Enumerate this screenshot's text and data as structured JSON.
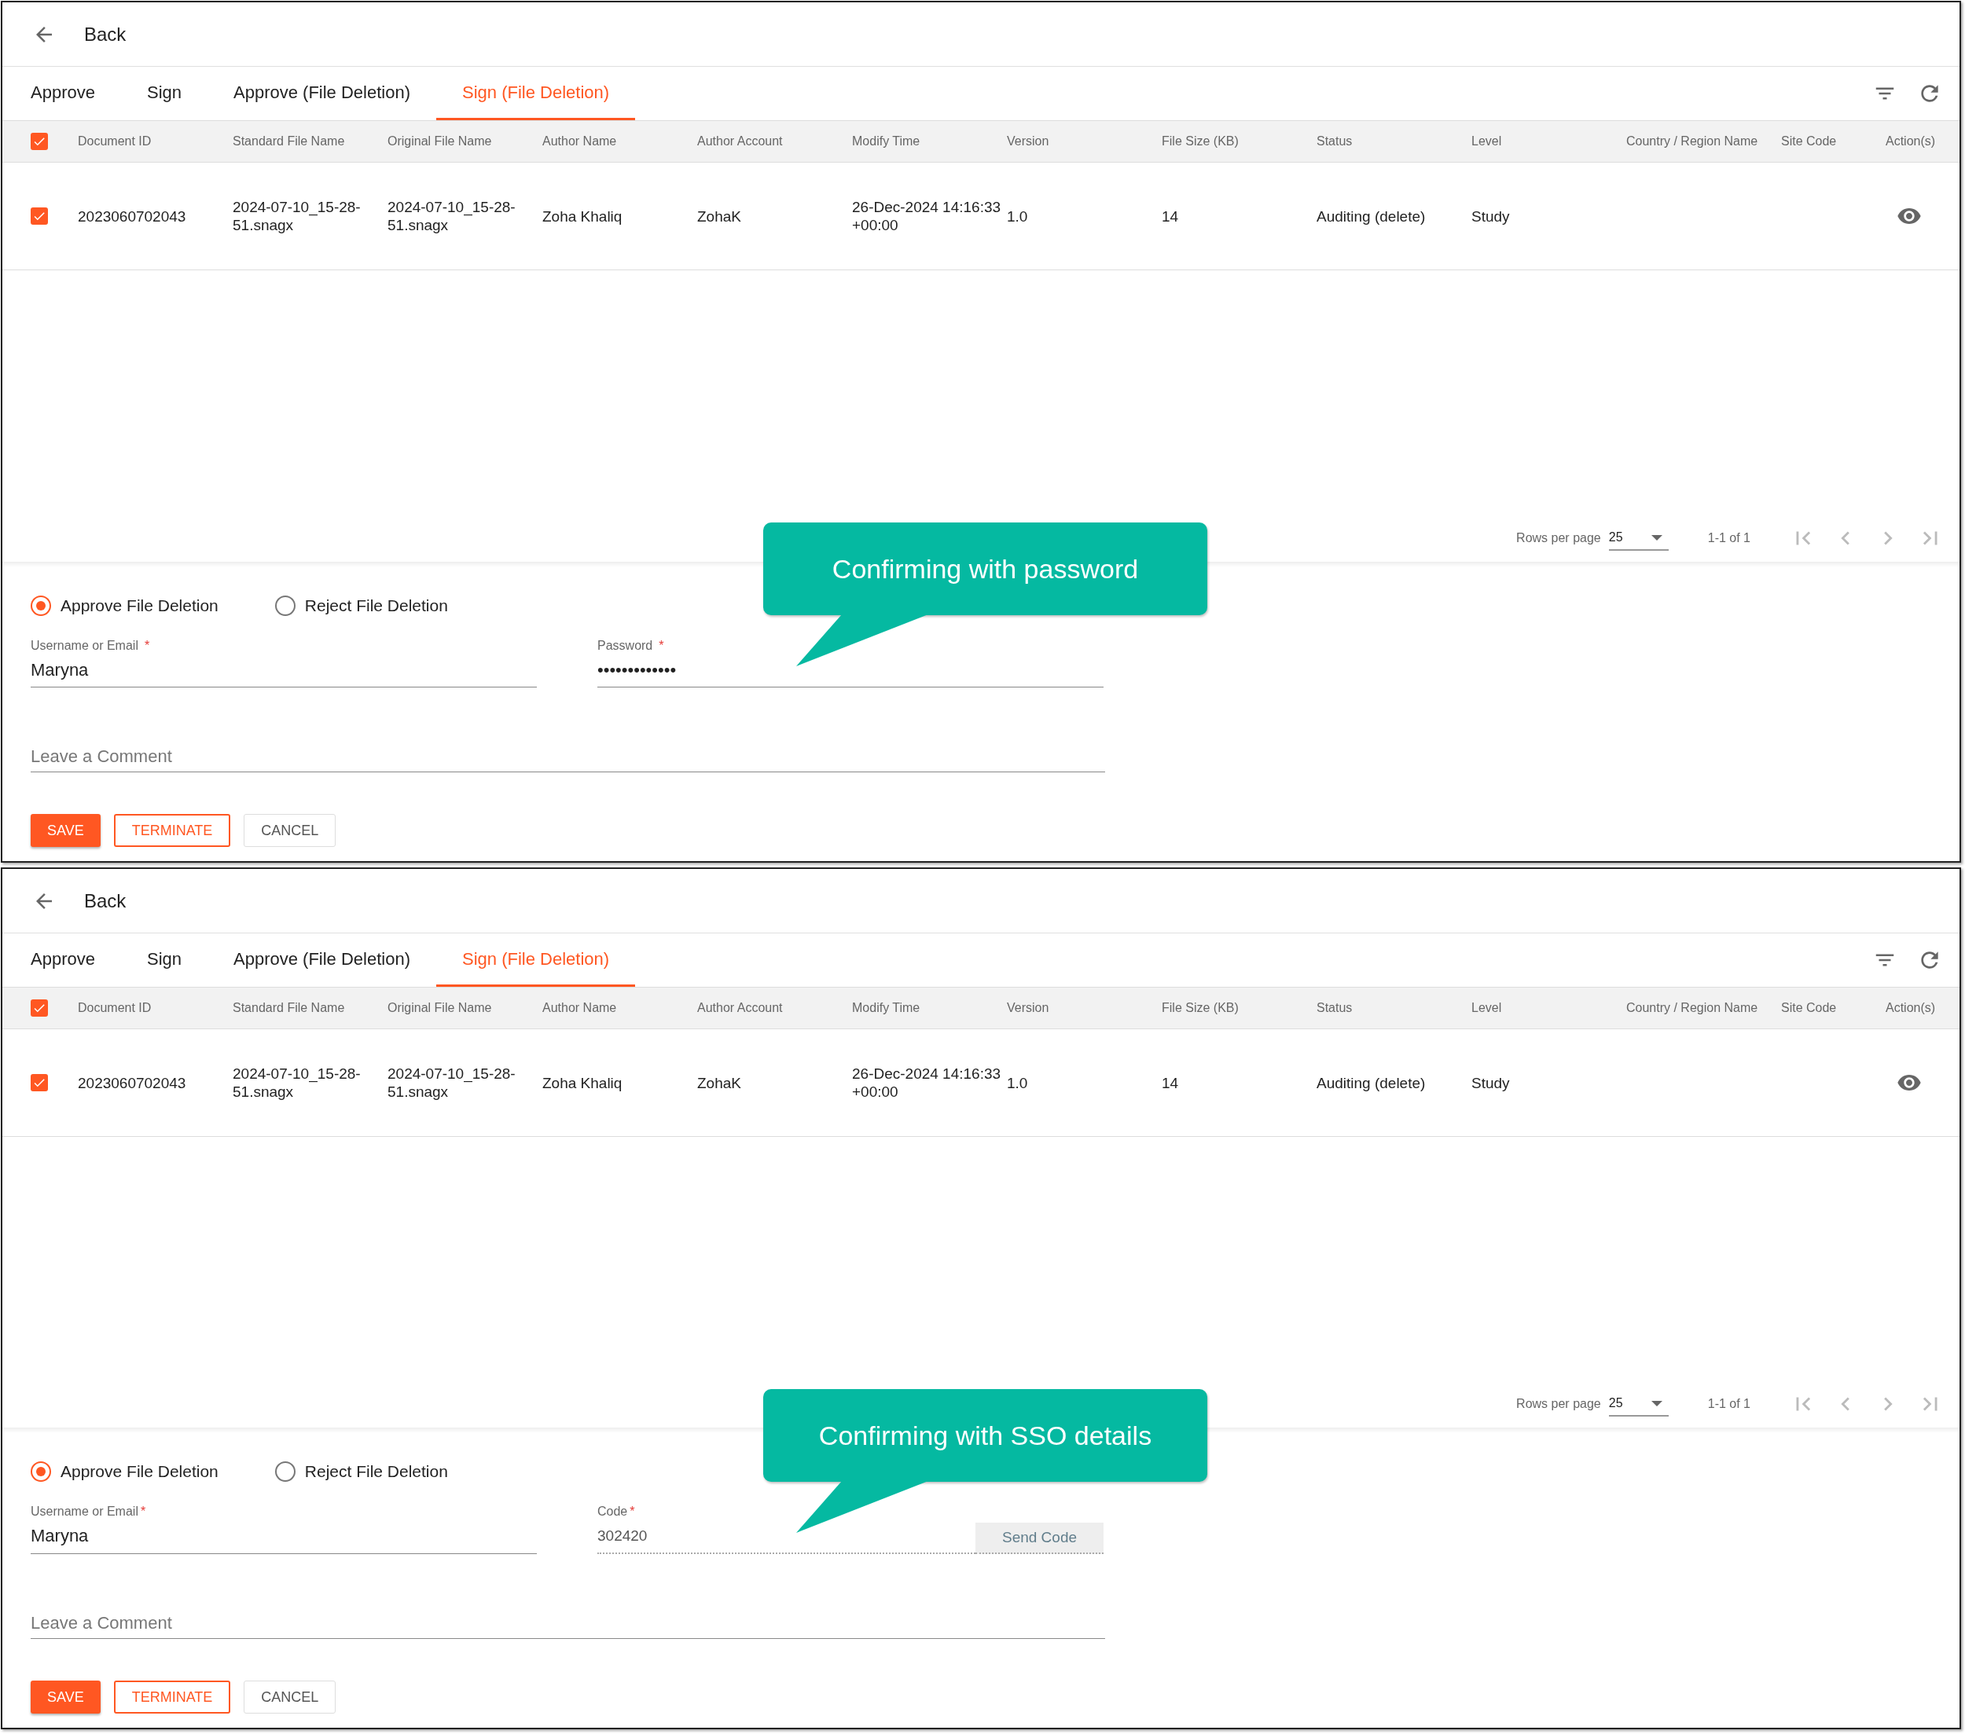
{
  "panels": [
    {
      "back": "Back",
      "tabs": [
        {
          "label": "Approve",
          "selected": false
        },
        {
          "label": "Sign",
          "selected": false
        },
        {
          "label": "Approve (File Deletion)",
          "selected": false
        },
        {
          "label": "Sign (File Deletion)",
          "selected": true
        }
      ],
      "header_checked": true,
      "columns": [
        "Document ID",
        "Standard File Name",
        "Original File Name",
        "Author Name",
        "Author Account",
        "Modify Time",
        "Version",
        "File Size (KB)",
        "Status",
        "Level",
        "Country / Region Name",
        "Site Code",
        "Action(s)"
      ],
      "rows": [
        {
          "checked": true,
          "cells": [
            "2023060702043",
            "2024-07-10_15-28-51.snagx",
            "2024-07-10_15-28-51.snagx",
            "Zoha Khaliq",
            "ZohaK",
            "26-Dec-2024 14:16:33 +00:00",
            "1.0",
            "14",
            "Auditing (delete)",
            "Study"
          ]
        }
      ],
      "pagination": {
        "rows_per_page_label": "Rows per page",
        "rows_per_page": "25",
        "range": "1-1 of 1"
      },
      "decision": [
        {
          "label": "Approve File Deletion",
          "selected": true
        },
        {
          "label": "Reject File Deletion",
          "selected": false
        }
      ],
      "fields": [
        {
          "kind": "text",
          "label": "Username or Email",
          "required_mark": "*",
          "value": "Maryna"
        },
        {
          "kind": "password",
          "label": "Password",
          "required_mark": "*",
          "value": "•••••••••••••"
        }
      ],
      "comment": {
        "placeholder": "Leave a Comment"
      },
      "buttons": [
        {
          "kind": "primary",
          "label": "SAVE"
        },
        {
          "kind": "outlined",
          "label": "TERMINATE"
        },
        {
          "kind": "plain",
          "label": "CANCEL"
        }
      ],
      "callout": "Confirming with password"
    },
    {
      "back": "Back",
      "tabs": [
        {
          "label": "Approve",
          "selected": false
        },
        {
          "label": "Sign",
          "selected": false
        },
        {
          "label": "Approve (File Deletion)",
          "selected": false
        },
        {
          "label": "Sign (File Deletion)",
          "selected": true
        }
      ],
      "header_checked": true,
      "columns": [
        "Document ID",
        "Standard File Name",
        "Original File Name",
        "Author Name",
        "Author Account",
        "Modify Time",
        "Version",
        "File Size (KB)",
        "Status",
        "Level",
        "Country / Region Name",
        "Site Code",
        "Action(s)"
      ],
      "rows": [
        {
          "checked": true,
          "cells": [
            "2023060702043",
            "2024-07-10_15-28-51.snagx",
            "2024-07-10_15-28-51.snagx",
            "Zoha Khaliq",
            "ZohaK",
            "26-Dec-2024 14:16:33 +00:00",
            "1.0",
            "14",
            "Auditing (delete)",
            "Study"
          ]
        }
      ],
      "pagination": {
        "rows_per_page_label": "Rows per page",
        "rows_per_page": "25",
        "range": "1-1 of 1"
      },
      "decision": [
        {
          "label": "Approve File Deletion",
          "selected": true
        },
        {
          "label": "Reject File Deletion",
          "selected": false
        }
      ],
      "fields": [
        {
          "kind": "text",
          "label": "Username or Email",
          "required_mark": "*",
          "value": "Maryna"
        },
        {
          "kind": "code",
          "label": "Code",
          "required_mark": "*",
          "value": "302420",
          "button": "Send Code"
        }
      ],
      "comment": {
        "placeholder": "Leave a Comment"
      },
      "buttons": [
        {
          "kind": "primary",
          "label": "SAVE"
        },
        {
          "kind": "outlined",
          "label": "TERMINATE"
        },
        {
          "kind": "plain",
          "label": "CANCEL"
        }
      ],
      "callout": "Confirming with SSO details"
    }
  ]
}
